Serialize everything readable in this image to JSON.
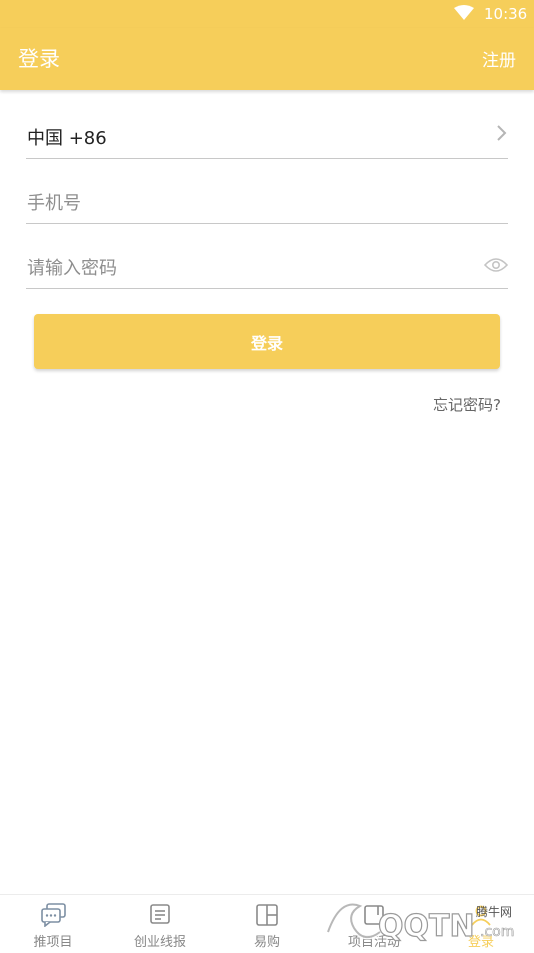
{
  "status_bar": {
    "time": "10:36",
    "wifi_icon": "wifi-icon"
  },
  "app_bar": {
    "title": "登录",
    "register_label": "注册"
  },
  "form": {
    "country_code": "中国 +86",
    "phone_placeholder": "手机号",
    "password_placeholder": "请输入密码",
    "login_button": "登录",
    "forgot_password": "忘记密码?"
  },
  "bottom_nav": {
    "items": [
      {
        "label": "推项目",
        "icon": "chat-bubbles-icon"
      },
      {
        "label": "创业线报",
        "icon": "document-icon"
      },
      {
        "label": "易购",
        "icon": "grid-panel-icon"
      },
      {
        "label": "项目活动",
        "icon": "activity-icon"
      },
      {
        "label": "登录",
        "icon": "user-icon"
      }
    ]
  },
  "watermark": {
    "brand_cn": "腾牛网",
    "brand_en": "QQTN.com"
  },
  "colors": {
    "accent": "#f6ce5a",
    "text_dark": "#222222",
    "placeholder": "#8e8e8e"
  }
}
